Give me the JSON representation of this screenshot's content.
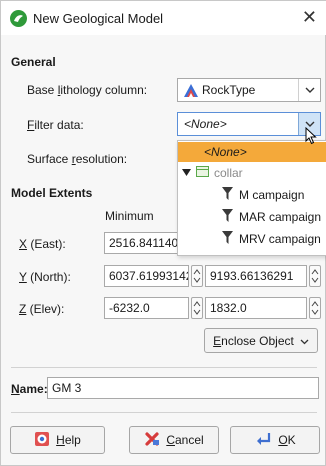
{
  "window": {
    "title": "New Geological Model",
    "close_glyph": "✕"
  },
  "general": {
    "heading": "General",
    "base_lithology": {
      "label_pre": "Base ",
      "label_u": "l",
      "label_post": "ithology column:",
      "value": "RockType",
      "icon": "rock-type-icon"
    },
    "filter_data": {
      "label_u": "F",
      "label_post": "ilter data:",
      "value": "<None>"
    },
    "surface_resolution": {
      "label_pre": "Surface ",
      "label_u": "r",
      "label_post": "esolution:"
    }
  },
  "dropdown": {
    "items": [
      {
        "label": "<None>",
        "selected": true,
        "icon": ""
      },
      {
        "label": "collar",
        "selected": false,
        "icon": "table-icon",
        "disabled": true
      },
      {
        "label": "M campaign",
        "selected": false,
        "icon": "filter-icon"
      },
      {
        "label": "MAR campaign",
        "selected": false,
        "icon": "filter-icon"
      },
      {
        "label": "MRV campaign",
        "selected": false,
        "icon": "filter-icon"
      }
    ]
  },
  "extents": {
    "heading": "Model Extents",
    "col_minimum": "Minimum",
    "rows": [
      {
        "label_u": "X",
        "label_post": " (East):",
        "min": "2516.841140",
        "max": ""
      },
      {
        "label_u": "Y",
        "label_post": " (North):",
        "min": "6037.61993142",
        "max": "9193.66136291"
      },
      {
        "label_u": "Z",
        "label_post": " (Elev):",
        "min": "-6232.0",
        "max": "1832.0"
      }
    ],
    "enclose_label_u": "E",
    "enclose_label_post": "nclose Object"
  },
  "name": {
    "label_u": "N",
    "label_post": "ame:",
    "value": "GM 3"
  },
  "buttons": {
    "help_u": "H",
    "help_post": "elp",
    "cancel_u": "C",
    "cancel_post": "ancel",
    "ok_u": "O",
    "ok_post": "K"
  },
  "colors": {
    "selected_item": "#f4a93a",
    "app_icon": "#2f9a3a"
  }
}
